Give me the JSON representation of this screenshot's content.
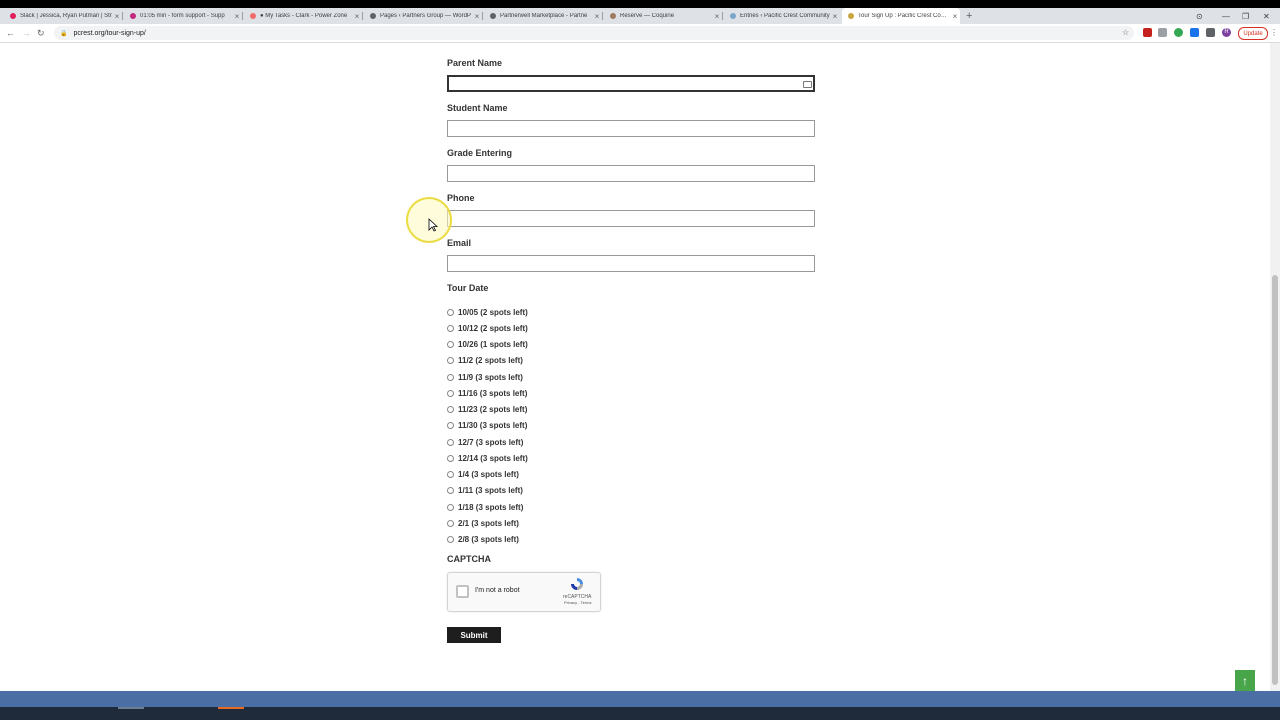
{
  "browser": {
    "tabs": [
      {
        "title": "Slack | Jessica, Ryan Putman | Str",
        "color": "#e01e5a"
      },
      {
        "title": "01:05 min - form support - Supp",
        "color": "#c3297c"
      },
      {
        "title": "● My Tasks - Clark - Power Zone",
        "color": "#f06a6a"
      },
      {
        "title": "Pages ‹ Partners Group — WordP",
        "color": "#5f6368"
      },
      {
        "title": "Partnerwell Marketplace - Partne",
        "color": "#5f6368"
      },
      {
        "title": "Reserve — Coquine",
        "color": "#9e7b5c"
      },
      {
        "title": "Entries ‹ Pacific Crest Community",
        "color": "#7aa7c7"
      },
      {
        "title": "Tour Sign Up : Pacific Crest Comm",
        "color": "#c9a43a"
      }
    ],
    "url": "pcrest.org/tour-sign-up/",
    "update_label": "Update",
    "profile_initial": "R"
  },
  "form": {
    "fields": [
      {
        "label": "Parent Name"
      },
      {
        "label": "Student Name"
      },
      {
        "label": "Grade Entering"
      },
      {
        "label": "Phone"
      },
      {
        "label": "Email"
      }
    ],
    "tour_label": "Tour Date",
    "tour_options": [
      "10/05 (2 spots left)",
      "10/12 (2 spots left)",
      "10/26 (1 spots left)",
      "11/2 (2 spots left)",
      "11/9 (3 spots left)",
      "11/16 (3 spots left)",
      "11/23 (2 spots left)",
      "11/30 (3 spots left)",
      "12/7 (3 spots left)",
      "12/14 (3 spots left)",
      "1/4 (3 spots left)",
      "1/11 (3 spots left)",
      "1/18 (3 spots left)",
      "2/1 (3 spots left)",
      "2/8 (3 spots left)"
    ],
    "captcha_label": "CAPTCHA",
    "captcha": {
      "checkbox_text": "I'm not a robot",
      "brand": "reCAPTCHA",
      "terms": "Privacy - Terms"
    },
    "submit_label": "Submit"
  },
  "back_to_top": "↑"
}
